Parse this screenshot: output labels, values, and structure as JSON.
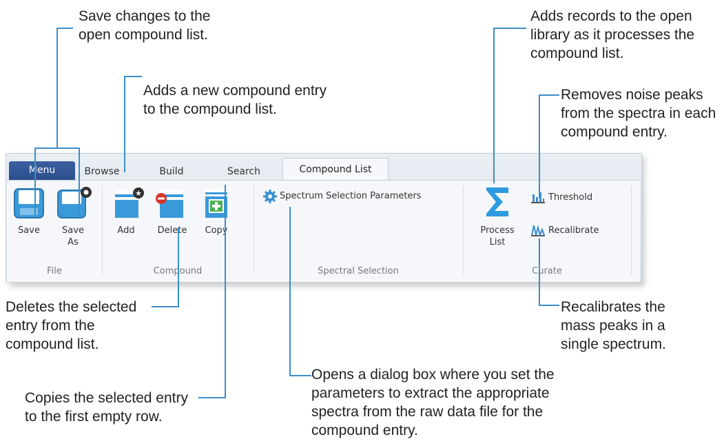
{
  "callouts": {
    "save": "Save changes to the\nopen compound list.",
    "add": "Adds a new compound entry\nto the compound list.",
    "process": "Adds records to the open\nlibrary as it processes the\ncompound list.",
    "threshold": "Removes noise peaks\nfrom the spectra in each\ncompound entry.",
    "delete": "Deletes the selected\nentry from the\ncompound list.",
    "copy": "Copies the selected entry\nto the first empty row.",
    "recalibrate": "Recalibrates the\nmass peaks in a\nsingle spectrum.",
    "spectrum": "Opens a dialog box where you set the\nparameters to extract the appropriate\nspectra from the raw data file for the\ncompound entry."
  },
  "tabs": {
    "menu": "Menu",
    "browse": "Browse",
    "build": "Build",
    "search": "Search",
    "compound_list": "Compound List"
  },
  "buttons": {
    "save": "Save",
    "save_as": "Save\nAs",
    "add": "Add",
    "delete": "Delete",
    "copy": "Copy",
    "spectrum_selection": "Spectrum Selection Parameters",
    "process_list": "Process\nList",
    "threshold": "Threshold",
    "recalibrate": "Recalibrate"
  },
  "groups": {
    "file": "File",
    "compound": "Compound",
    "spectral_selection": "Spectral Selection",
    "curate": "Curate"
  },
  "colors": {
    "callout_line": "#3c8dc8",
    "menu_tab": "#2b4e8c",
    "icon_blue": "#3a9ad9"
  }
}
